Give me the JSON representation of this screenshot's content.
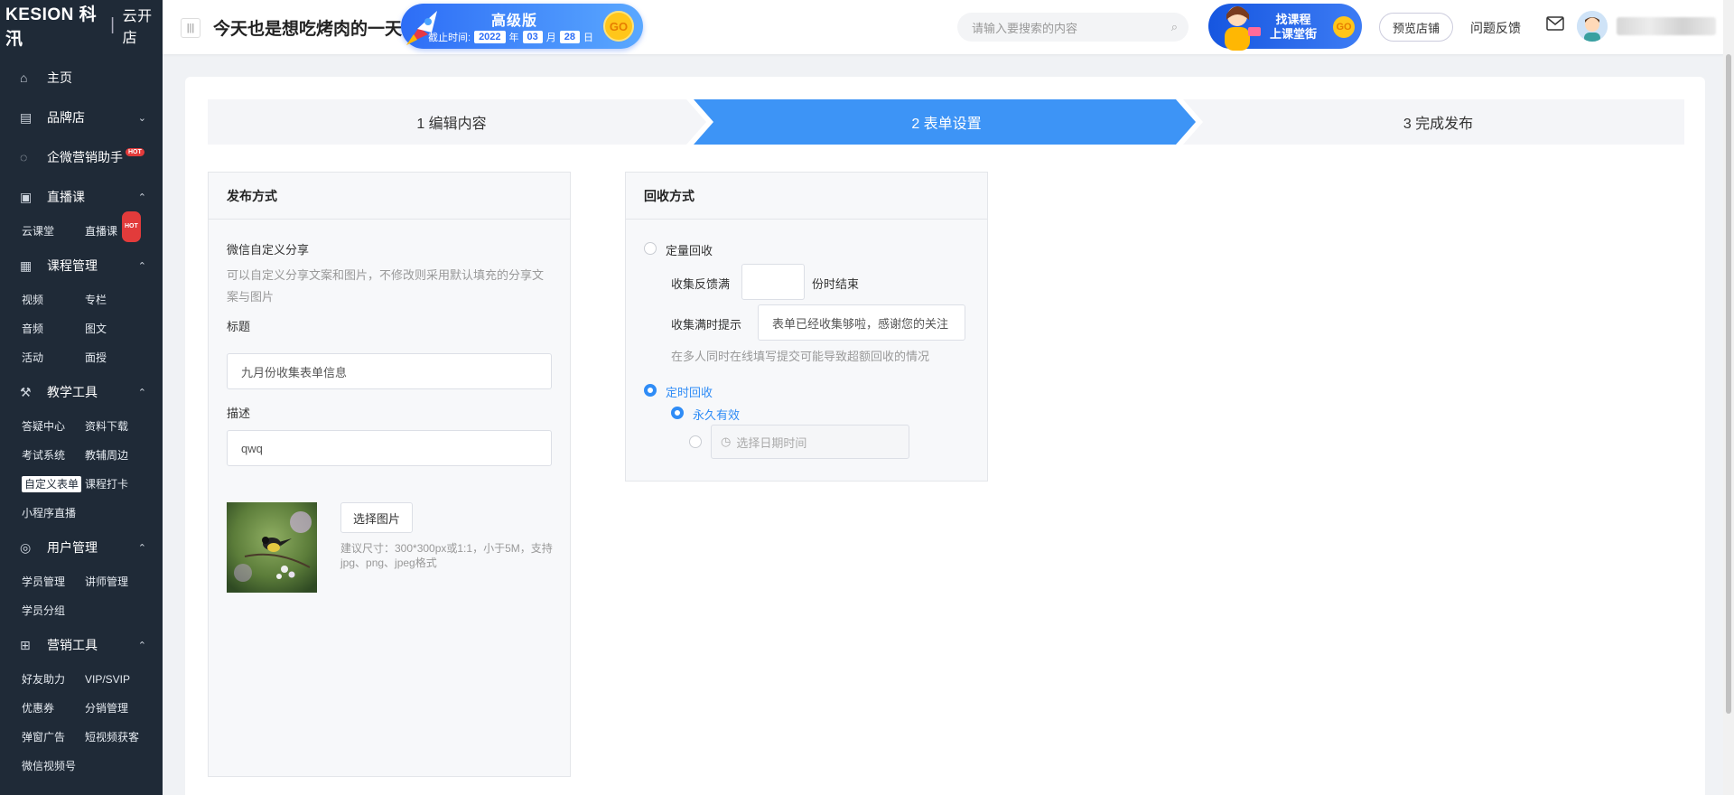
{
  "sidebar": {
    "logo": {
      "brand": "KESION 科汛",
      "store": "云开店"
    },
    "home": "主页",
    "brand_store": "品牌店",
    "wecom": "企微营销助手",
    "hot": "HOT",
    "live": {
      "title": "直播课",
      "items": [
        "云课堂",
        "直播课"
      ]
    },
    "course": {
      "title": "课程管理",
      "items": [
        "视频",
        "专栏",
        "音频",
        "图文",
        "活动",
        "面授"
      ]
    },
    "teaching": {
      "title": "教学工具",
      "items": [
        "答疑中心",
        "资料下载",
        "考试系统",
        "教辅周边",
        "自定义表单",
        "课程打卡",
        "小程序直播"
      ]
    },
    "users": {
      "title": "用户管理",
      "items": [
        "学员管理",
        "讲师管理",
        "学员分组"
      ]
    },
    "marketing": {
      "title": "营销工具",
      "items": [
        "好友助力",
        "VIP/SVIP",
        "优惠券",
        "分销管理",
        "弹窗广告",
        "短视频获客",
        "微信视频号"
      ]
    }
  },
  "topbar": {
    "title": "今天也是想吃烤肉的一天",
    "pro": {
      "tier": "高级版",
      "expire_label": "截止时间:",
      "year": "2022",
      "year_unit": "年",
      "month": "03",
      "month_unit": "月",
      "day": "28",
      "day_unit": "日",
      "go": "GO"
    },
    "search_placeholder": "请输入要搜索的内容",
    "course_banner": {
      "line1": "找课程",
      "line2": "上课堂街",
      "go": "GO"
    },
    "preview": "预览店铺",
    "feedback": "问题反馈"
  },
  "steps": [
    "1 编辑内容",
    "2 表单设置",
    "3 完成发布"
  ],
  "publish": {
    "heading": "发布方式",
    "share_title": "微信自定义分享",
    "share_hint": "可以自定义分享文案和图片，不修改则采用默认填充的分享文案与图片",
    "title_label": "标题",
    "title_value": "九月份收集表单信息",
    "desc_label": "描述",
    "desc_value": "qwq",
    "choose_image": "选择图片",
    "image_hint": "建议尺寸：300*300px或1:1，小于5M，支持jpg、png、jpeg格式"
  },
  "recycle": {
    "heading": "回收方式",
    "quota": "定量回收",
    "collect_full": "收集反馈满",
    "collect_end": "份时结束",
    "full_tip_label": "收集满时提示",
    "full_tip_value": "表单已经收集够啦，感谢您的关注",
    "warning": "在多人同时在线填写提交可能导致超额回收的情况",
    "timed": "定时回收",
    "permanent": "永久有效",
    "date_placeholder": "选择日期时间"
  },
  "colors": {
    "sidebar": "#1f2a37",
    "accent": "#2f8cf6",
    "step_active": "#3d94f6"
  }
}
